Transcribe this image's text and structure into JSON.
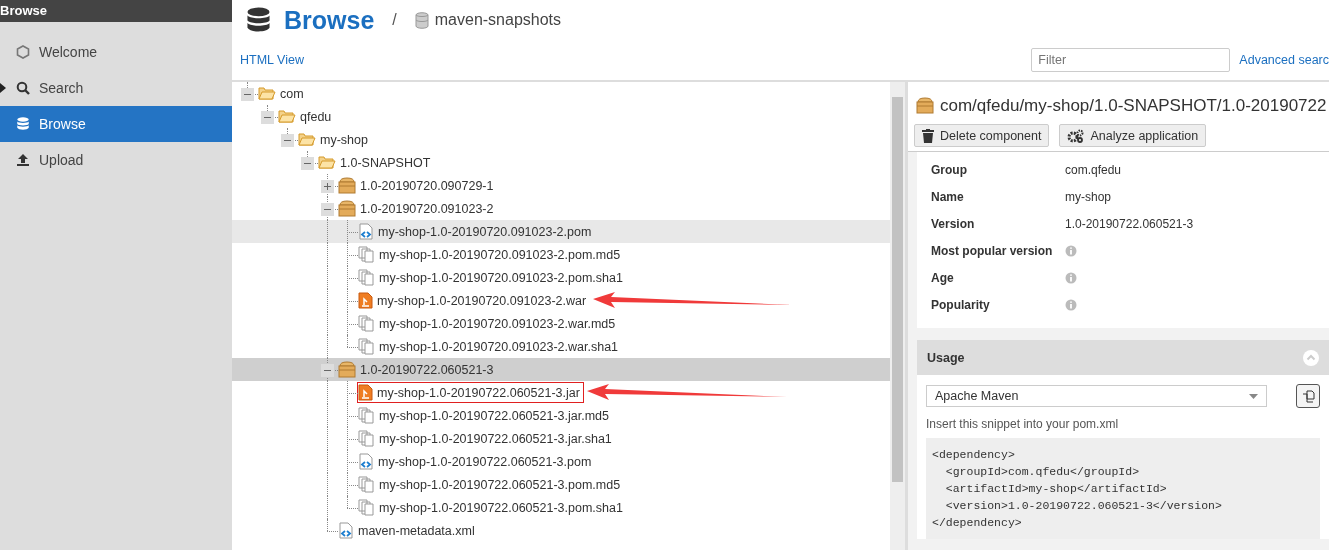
{
  "sidebar": {
    "title": "Browse",
    "items": [
      {
        "label": "Welcome",
        "selected": false,
        "expandable": false
      },
      {
        "label": "Search",
        "selected": false,
        "expandable": true
      },
      {
        "label": "Browse",
        "selected": true,
        "expandable": false
      },
      {
        "label": "Upload",
        "selected": false,
        "expandable": false
      }
    ]
  },
  "header": {
    "title": "Browse",
    "separator": "/",
    "repository": "maven-snapshots"
  },
  "toolbar": {
    "html_view": "HTML View",
    "filter": {
      "placeholder": "Filter"
    },
    "advanced_search": "Advanced searc"
  },
  "tree": [
    {
      "label": "com",
      "kind": "folder",
      "expanded": true,
      "selected": false,
      "hovered": false,
      "children": [
        {
          "label": "qfedu",
          "kind": "folder",
          "expanded": true,
          "selected": false,
          "hovered": false,
          "children": [
            {
              "label": "my-shop",
              "kind": "folder",
              "expanded": true,
              "selected": false,
              "hovered": false,
              "children": [
                {
                  "label": "1.0-SNAPSHOT",
                  "kind": "folder",
                  "expanded": true,
                  "selected": false,
                  "hovered": false,
                  "children": [
                    {
                      "label": "1.0-20190720.090729-1",
                      "kind": "component",
                      "expanded": false,
                      "selected": false,
                      "hovered": false
                    },
                    {
                      "label": "1.0-20190720.091023-2",
                      "kind": "component",
                      "expanded": true,
                      "selected": false,
                      "hovered": false,
                      "children": [
                        {
                          "label": "my-shop-1.0-20190720.091023-2.pom",
                          "kind": "pom",
                          "selected": false,
                          "hovered": true
                        },
                        {
                          "label": "my-shop-1.0-20190720.091023-2.pom.md5",
                          "kind": "hash",
                          "selected": false,
                          "hovered": false
                        },
                        {
                          "label": "my-shop-1.0-20190720.091023-2.pom.sha1",
                          "kind": "hash",
                          "selected": false,
                          "hovered": false
                        },
                        {
                          "label": "my-shop-1.0-20190720.091023-2.war",
                          "kind": "archive",
                          "selected": false,
                          "hovered": false,
                          "arrow": true
                        },
                        {
                          "label": "my-shop-1.0-20190720.091023-2.war.md5",
                          "kind": "hash",
                          "selected": false,
                          "hovered": false
                        },
                        {
                          "label": "my-shop-1.0-20190720.091023-2.war.sha1",
                          "kind": "hash",
                          "selected": false,
                          "hovered": false
                        }
                      ]
                    },
                    {
                      "label": "1.0-20190722.060521-3",
                      "kind": "component",
                      "expanded": true,
                      "selected": true,
                      "hovered": false,
                      "children": [
                        {
                          "label": "my-shop-1.0-20190722.060521-3.jar",
                          "kind": "archive",
                          "selected": false,
                          "hovered": false,
                          "arrow": true,
                          "outlined": true
                        },
                        {
                          "label": "my-shop-1.0-20190722.060521-3.jar.md5",
                          "kind": "hash",
                          "selected": false,
                          "hovered": false
                        },
                        {
                          "label": "my-shop-1.0-20190722.060521-3.jar.sha1",
                          "kind": "hash",
                          "selected": false,
                          "hovered": false
                        },
                        {
                          "label": "my-shop-1.0-20190722.060521-3.pom",
                          "kind": "pom",
                          "selected": false,
                          "hovered": false
                        },
                        {
                          "label": "my-shop-1.0-20190722.060521-3.pom.md5",
                          "kind": "hash",
                          "selected": false,
                          "hovered": false
                        },
                        {
                          "label": "my-shop-1.0-20190722.060521-3.pom.sha1",
                          "kind": "hash",
                          "selected": false,
                          "hovered": false
                        }
                      ]
                    },
                    {
                      "label": "maven-metadata.xml",
                      "kind": "pom",
                      "selected": false,
                      "hovered": false
                    }
                  ]
                }
              ]
            }
          ]
        }
      ]
    }
  ],
  "detail": {
    "path": "com/qfedu/my-shop/1.0-SNAPSHOT/1.0-20190722",
    "buttons": [
      {
        "label": "Delete component"
      },
      {
        "label": "Analyze application"
      }
    ],
    "fields": [
      {
        "label": "Group",
        "value": "com.qfedu"
      },
      {
        "label": "Name",
        "value": "my-shop"
      },
      {
        "label": "Version",
        "value": "1.0-20190722.060521-3"
      },
      {
        "label": "Most popular version",
        "info": true
      },
      {
        "label": "Age",
        "info": true
      },
      {
        "label": "Popularity",
        "info": true
      }
    ],
    "usage": {
      "title": "Usage",
      "expanded": true,
      "format": "Apache Maven",
      "hint": "Insert this snippet into your pom.xml",
      "snippet": [
        "<dependency>",
        "  <groupId>com.qfedu</groupId>",
        "  <artifactId>my-shop</artifactId>",
        "  <version>1.0-20190722.060521-3</version>",
        "</dependency>"
      ]
    }
  }
}
